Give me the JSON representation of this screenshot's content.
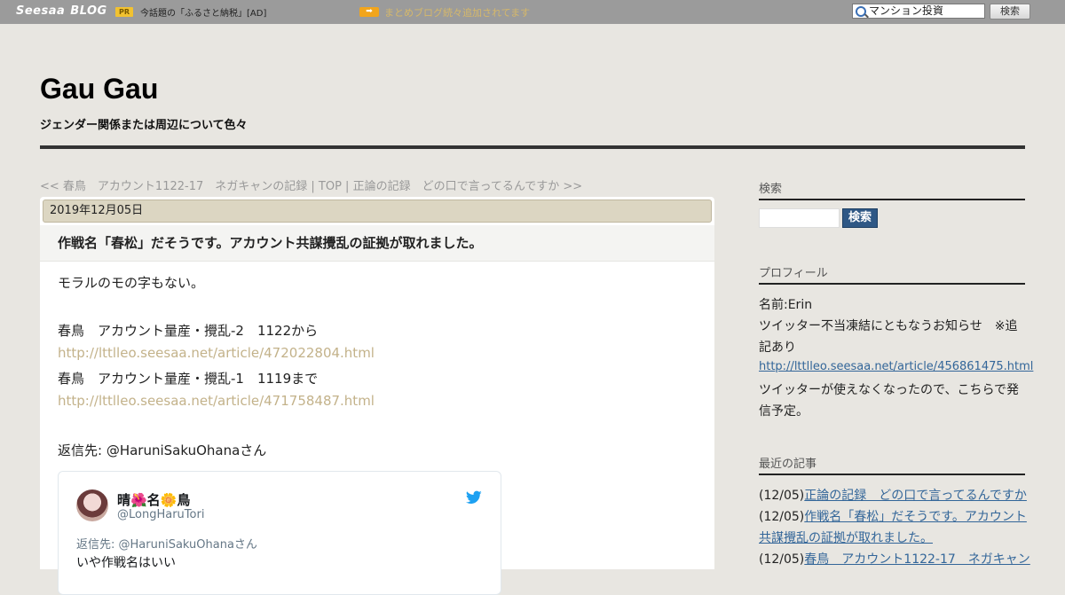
{
  "topbar": {
    "brand": "Seesaa",
    "brand_sub": "BLOG",
    "pr_badge": "PR",
    "pr_text": "今話題の「ふるさと納税」[AD]",
    "arrow_badge": "➡",
    "notice": "まとめブログ続々追加されてます",
    "search_value": "マンション投資",
    "search_button": "検索"
  },
  "header": {
    "title": "Gau Gau",
    "description": "ジェンダー関係または周辺について色々"
  },
  "nav": {
    "prev": "<< 春鳥　アカウント1122-17　ネガキャンの記録",
    "sep1": " | ",
    "top": "TOP",
    "sep2": " | ",
    "next": "正論の記録　どの口で言ってるんですか >>"
  },
  "article": {
    "date": "2019年12月05日",
    "title": "作戦名「春松」だそうです。アカウント共謀攪乱の証拠が取れました。",
    "lines": [
      "モラルのモの字もない。",
      "春鳥　アカウント量産・攪乱-2　1122から",
      "http://lttlleo.seesaa.net/article/472022804.html",
      "春鳥　アカウント量産・攪乱-1　1119まで",
      "http://lttlleo.seesaa.net/article/471758487.html",
      "返信先: @HaruniSakuOhanaさん"
    ]
  },
  "tweet": {
    "name": "晴🌺名🌼鳥",
    "handle": "@LongHaruTori",
    "reply_to": "返信先: @HaruniSakuOhanaさん",
    "body": "いや作戦名はいい",
    "bird_color": "#1da1f2"
  },
  "sidebar": {
    "search_heading": "検索",
    "search_button": "検索",
    "profile_heading": "プロフィール",
    "profile_name": "名前:Erin",
    "profile_line1": "ツイッター不当凍結にともなうお知らせ　※追",
    "profile_line2": "記あり",
    "profile_link": "http://lttlleo.seesaa.net/article/456861475.html",
    "profile_line3": "ツイッターが使えなくなったので、こちらで発",
    "profile_line4": "信予定。",
    "recent_heading": "最近の記事",
    "recent": [
      {
        "date": "(12/05)",
        "title": "正論の記録　どの口で言ってるんですか"
      },
      {
        "date": "(12/05)",
        "title": "作戦名「春松」だそうです。アカウント"
      },
      {
        "date": "",
        "title": "共謀攪乱の証拠が取れました。"
      },
      {
        "date": "(12/05)",
        "title": "春鳥　アカウント1122-17　ネガキャン"
      }
    ]
  }
}
